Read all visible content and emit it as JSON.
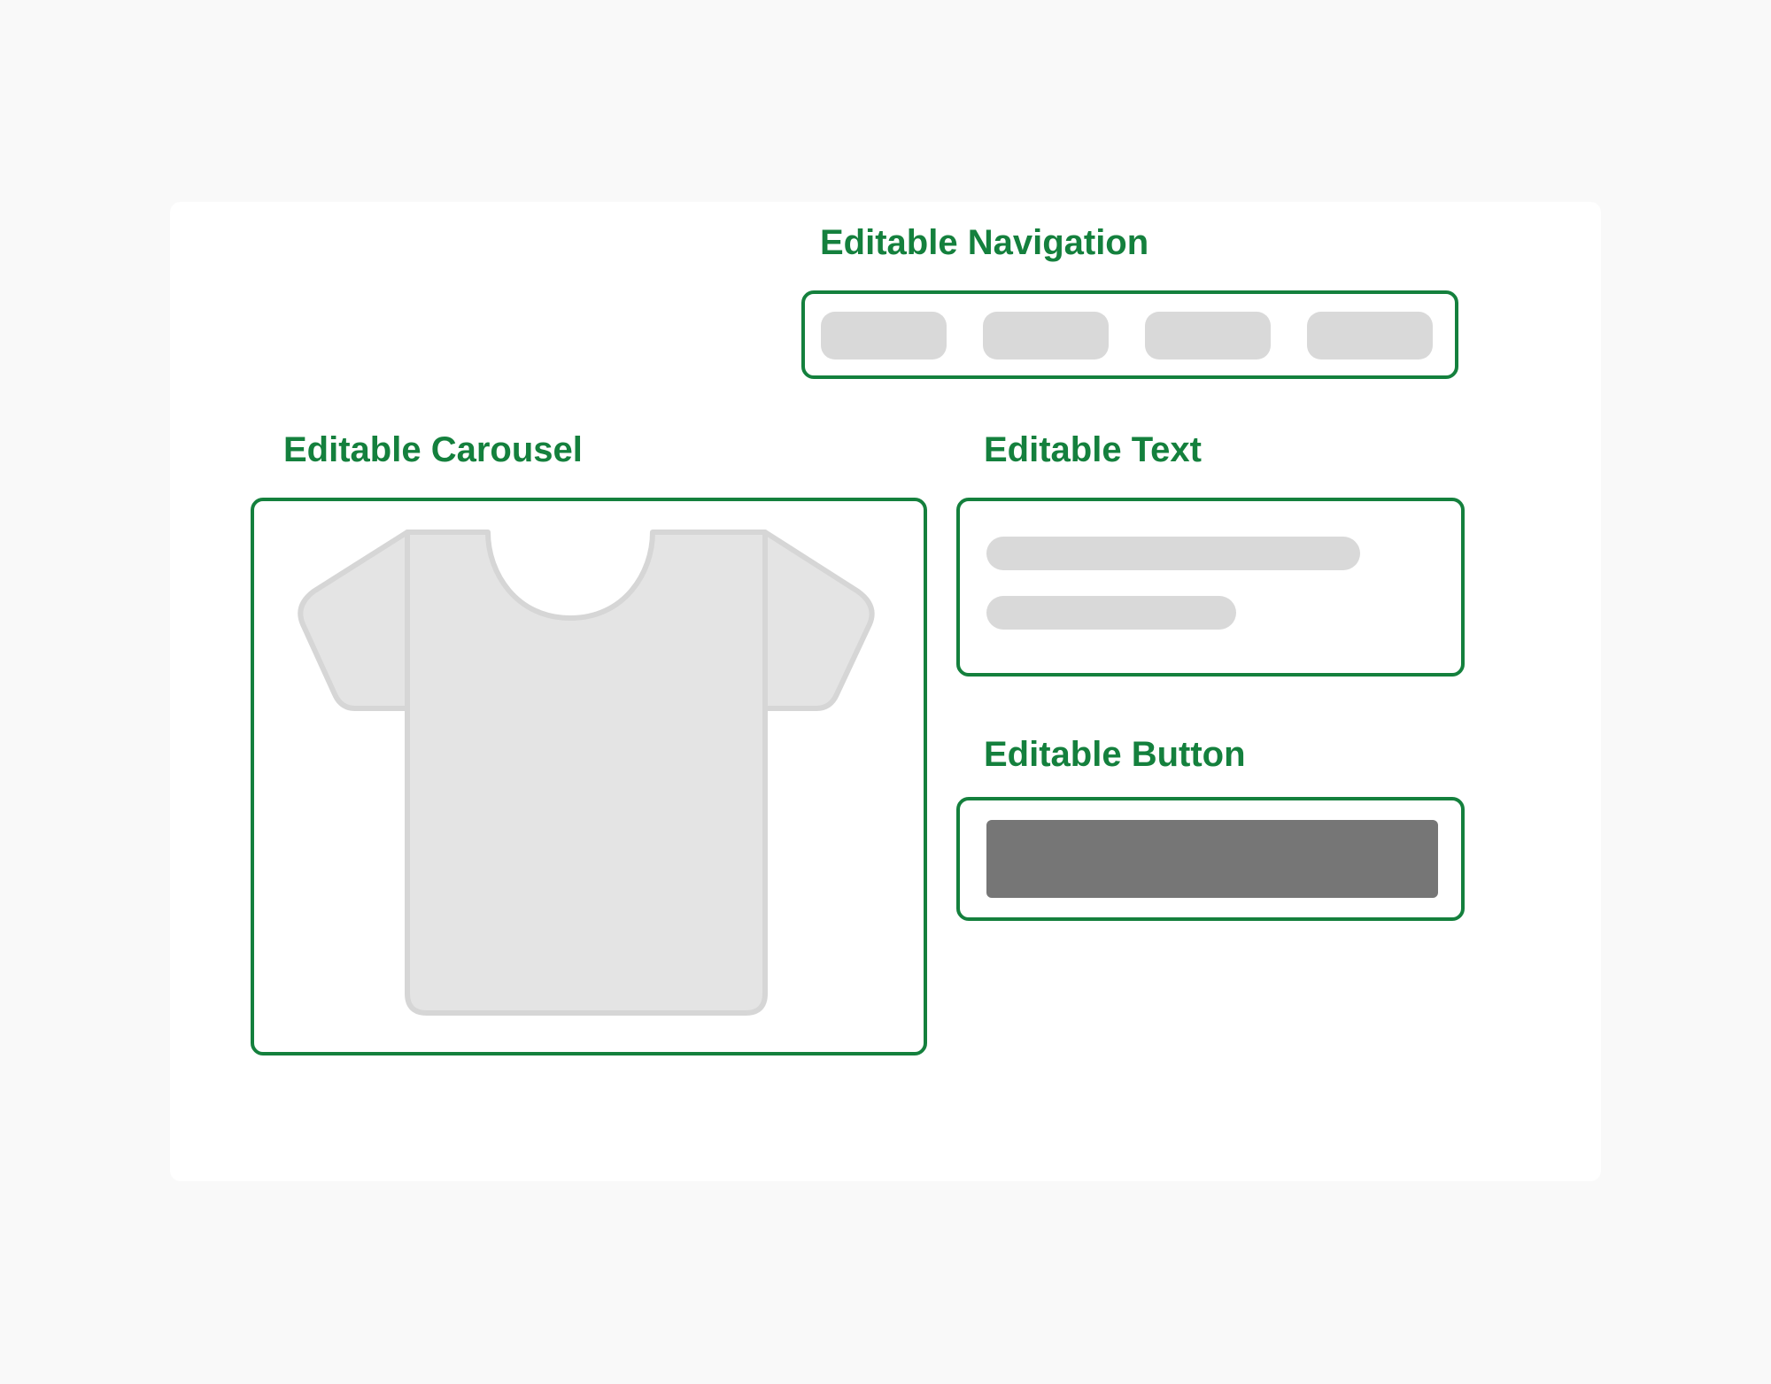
{
  "regions": {
    "navigation": {
      "label": "Editable Navigation",
      "item_count": 4
    },
    "carousel": {
      "label": "Editable Carousel",
      "image_icon": "t-shirt-icon"
    },
    "text": {
      "label": "Editable Text",
      "line_count": 2
    },
    "button": {
      "label": "Editable Button"
    }
  },
  "colors": {
    "accent": "#14803d",
    "placeholder": "#d9d9d9",
    "button_fill": "#767676",
    "shirt_fill": "#e4e4e4",
    "shirt_stroke": "#d6d6d6",
    "page_background": "#f9f9f9",
    "card_background": "#ffffff"
  }
}
